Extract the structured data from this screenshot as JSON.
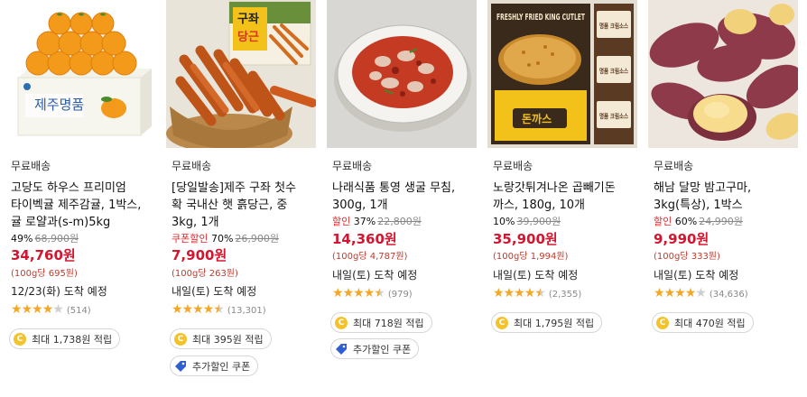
{
  "products": [
    {
      "image": "jeju-tangerine-box",
      "shipping": "무료배송",
      "title_lines": [
        "고당도 하우스 프리미엄",
        "타이벡귤 제주감귤, 1박스,",
        "귤 로얄과(s-m)5kg"
      ],
      "discount_label": "",
      "discount_pct": "49%",
      "original_price": "68,900원",
      "price": "34,760원",
      "unit_price": "(100g당 695원)",
      "delivery": "12/23(화) 도착 예정",
      "rating": 4,
      "review_count": "(514)",
      "reward": "최대 1,738원 적립",
      "coupon": ""
    },
    {
      "image": "jeju-carrots-basket",
      "shipping": "무료배송",
      "title_lines": [
        "[당일발송]제주 구좌 첫수",
        "확 국내산 햇 흙당근, 중",
        "3kg, 1개"
      ],
      "discount_label": "쿠폰할인",
      "discount_pct": "70%",
      "original_price": "26,900원",
      "price": "7,900원",
      "unit_price": "(100g당 263원)",
      "delivery": "내일(토) 도착 예정",
      "rating": 4.5,
      "review_count": "(13,301)",
      "reward": "최대 395원 적립",
      "coupon": "추가할인 쿠폰"
    },
    {
      "image": "spicy-oyster-dish",
      "shipping": "무료배송",
      "title_lines": [
        "나래식품 통영 생굴 무침,",
        "300g, 1개"
      ],
      "discount_label": "할인",
      "discount_pct": "37%",
      "original_price": "22,800원",
      "price": "14,360원",
      "unit_price": "(100g당 4,787원)",
      "delivery": "내일(토) 도착 예정",
      "rating": 4.5,
      "review_count": "(979)",
      "reward": "최대 718원 적립",
      "coupon": "추가할인 쿠폰"
    },
    {
      "image": "pork-cutlet-package",
      "shipping": "무료배송",
      "title_lines": [
        "노랑갓튀겨나온 곱빼기돈",
        "까스, 180g, 10개"
      ],
      "discount_label": "",
      "discount_pct": "10%",
      "original_price": "39,900원",
      "price": "35,900원",
      "unit_price": "(100g당 1,994원)",
      "delivery": "내일(토) 도착 예정",
      "rating": 4.5,
      "review_count": "(2,355)",
      "reward": "최대 1,795원 적립",
      "coupon": ""
    },
    {
      "image": "sweet-potatoes",
      "shipping": "무료배송",
      "title_lines": [
        "해남 달망 밤고구마,",
        "3kg(특상), 1박스"
      ],
      "discount_label": "할인",
      "discount_pct": "60%",
      "original_price": "24,990원",
      "price": "9,990원",
      "unit_price": "(100g당 333원)",
      "delivery": "내일(토) 도착 예정",
      "rating": 4,
      "review_count": "(34,636)",
      "reward": "최대 470원 적립",
      "coupon": ""
    }
  ],
  "image_text": {
    "tangerine_box": "제주명품",
    "carrot_sign_top": "구좌",
    "carrot_sign_bottom": "당근",
    "cutlet_brand": "FRESHLY FRIED KING CUTLET",
    "cutlet_label": "돈까스",
    "cutlet_sauce": "명품 크림소스"
  },
  "colors": {
    "price": "#d3162f",
    "discount_label": "#e52528",
    "star": "#f5a623",
    "coin": "#f4c22b",
    "coupon_icon": "#2f5fd0"
  },
  "icons": {
    "coin": "reward-coin-icon",
    "coupon": "coupon-tag-icon",
    "star": "star-icon"
  }
}
